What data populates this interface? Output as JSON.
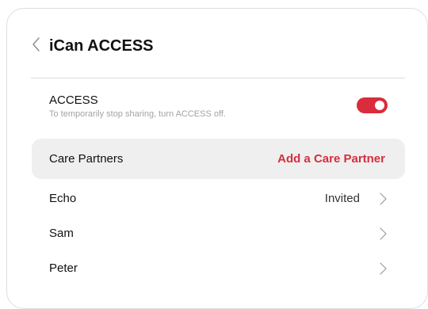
{
  "header": {
    "back_icon": "chevron-left-icon",
    "title": "iCan ACCESS"
  },
  "access": {
    "title": "ACCESS",
    "description": "To temporarily stop sharing, turn ACCESS off.",
    "toggle_on": true,
    "toggle_color": "#d92c3c"
  },
  "care_partners": {
    "label": "Care Partners",
    "add_label": "Add a Care Partner",
    "accent_color": "#d42f3d"
  },
  "partners": [
    {
      "name": "Echo",
      "status": "Invited"
    },
    {
      "name": "Sam",
      "status": ""
    },
    {
      "name": "Peter",
      "status": ""
    }
  ],
  "row_icon": "chevron-right-icon"
}
